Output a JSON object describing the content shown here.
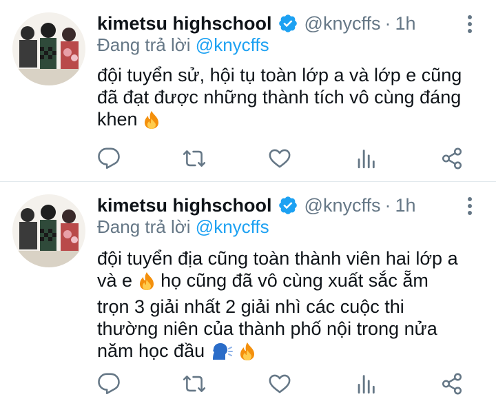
{
  "tweets": [
    {
      "name": "kimetsu highschool",
      "handle": "@knycffs",
      "separator": "·",
      "time": "1h",
      "reply_prefix": "Đang trả lời",
      "reply_mention": "@knycffs",
      "lines": [
        "đội tuyển sử, hội tụ toàn lớp a và lớp e cũng",
        "đã đạt được những thành tích vô cùng đáng",
        "khen"
      ]
    },
    {
      "name": "kimetsu highschool",
      "handle": "@knycffs",
      "separator": "·",
      "time": "1h",
      "reply_prefix": "Đang trả lời",
      "reply_mention": "@knycffs",
      "lines": [
        "đội tuyển địa cũng toàn thành viên hai lớp a",
        "và e",
        "họ cũng đã vô cùng xuất sắc ẵm",
        "trọn 3 giải nhất 2 giải nhì các cuộc thi",
        "thường niên của thành phố nội trong nửa",
        "năm học đầu"
      ]
    }
  ],
  "icons": {
    "verified": "verified-badge-icon",
    "more": "more-options-icon",
    "reply": "reply-icon",
    "retweet": "retweet-icon",
    "like": "heart-icon",
    "analytics": "analytics-icon",
    "share": "share-icon",
    "fire": "fire-emoji",
    "speaking": "speaking-head-emoji"
  },
  "colors": {
    "text": "#0f1419",
    "secondary": "#657786",
    "accent": "#1da1f2",
    "divider": "#e1e8ed"
  }
}
